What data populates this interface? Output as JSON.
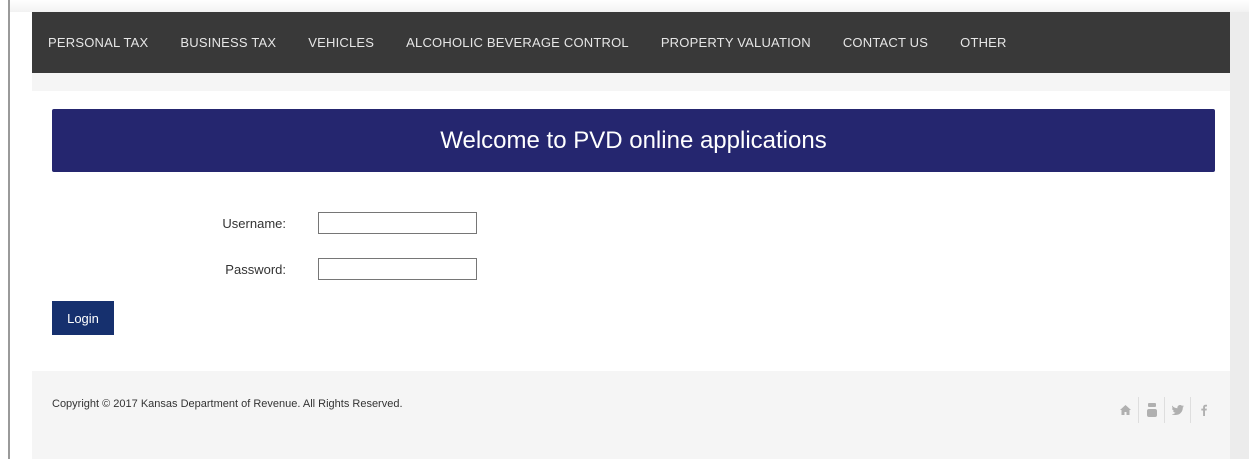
{
  "nav": {
    "items": [
      "PERSONAL TAX",
      "BUSINESS TAX",
      "VEHICLES",
      "ALCOHOLIC BEVERAGE CONTROL",
      "PROPERTY VALUATION",
      "CONTACT US",
      "OTHER"
    ]
  },
  "banner": {
    "title": "Welcome to PVD online applications"
  },
  "form": {
    "username_label": "Username:",
    "username_value": "",
    "password_label": "Password:",
    "password_value": "",
    "login_label": "Login"
  },
  "footer": {
    "copyright": "Copyright © 2017 Kansas Department of Revenue. All Rights Reserved.",
    "social_icons": [
      "home-icon",
      "youtube-icon",
      "twitter-icon",
      "facebook-icon"
    ]
  },
  "colors": {
    "nav_bg": "#393939",
    "banner_bg": "#25266f",
    "button_bg": "#16306e"
  }
}
